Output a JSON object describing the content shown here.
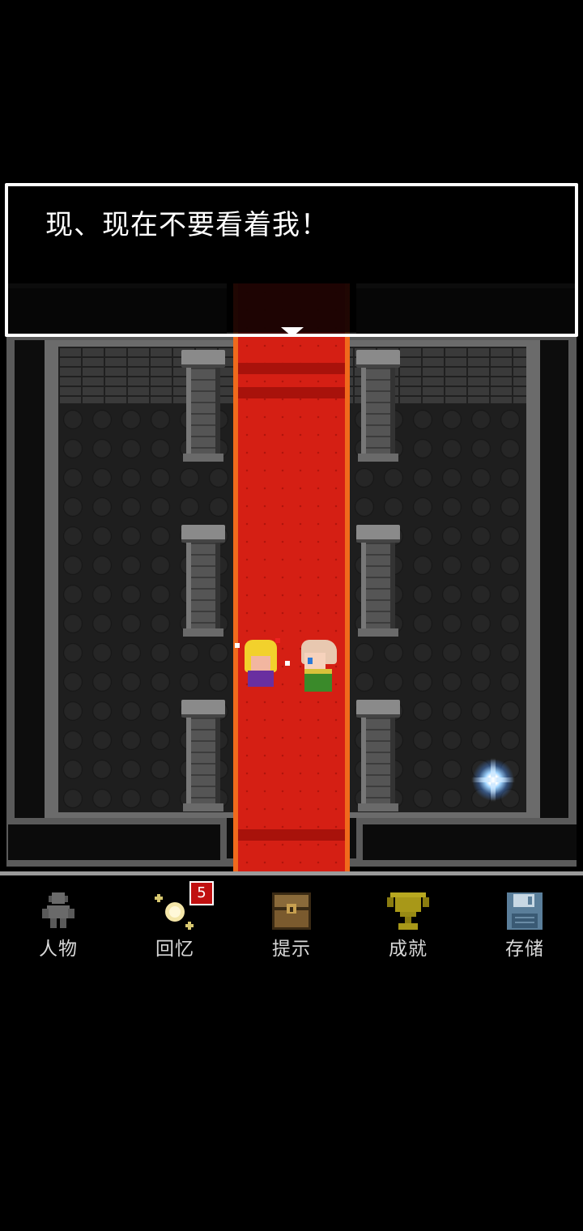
{
  "dialog": {
    "text": "现、现在不要看着我！"
  },
  "menu": {
    "items": [
      {
        "label": "人物",
        "icon": "character-icon"
      },
      {
        "label": "回忆",
        "icon": "memory-sparkle-icon",
        "badge": "5"
      },
      {
        "label": "提示",
        "icon": "treasure-chest-icon"
      },
      {
        "label": "成就",
        "icon": "trophy-icon"
      },
      {
        "label": "存储",
        "icon": "floppy-disk-icon"
      }
    ]
  },
  "colors": {
    "carpet": "#d51f14",
    "carpet_border": "#f06a1c",
    "dialog_border": "#ffffff",
    "badge": "#c01010",
    "menu_text": "#d8d8d8"
  }
}
